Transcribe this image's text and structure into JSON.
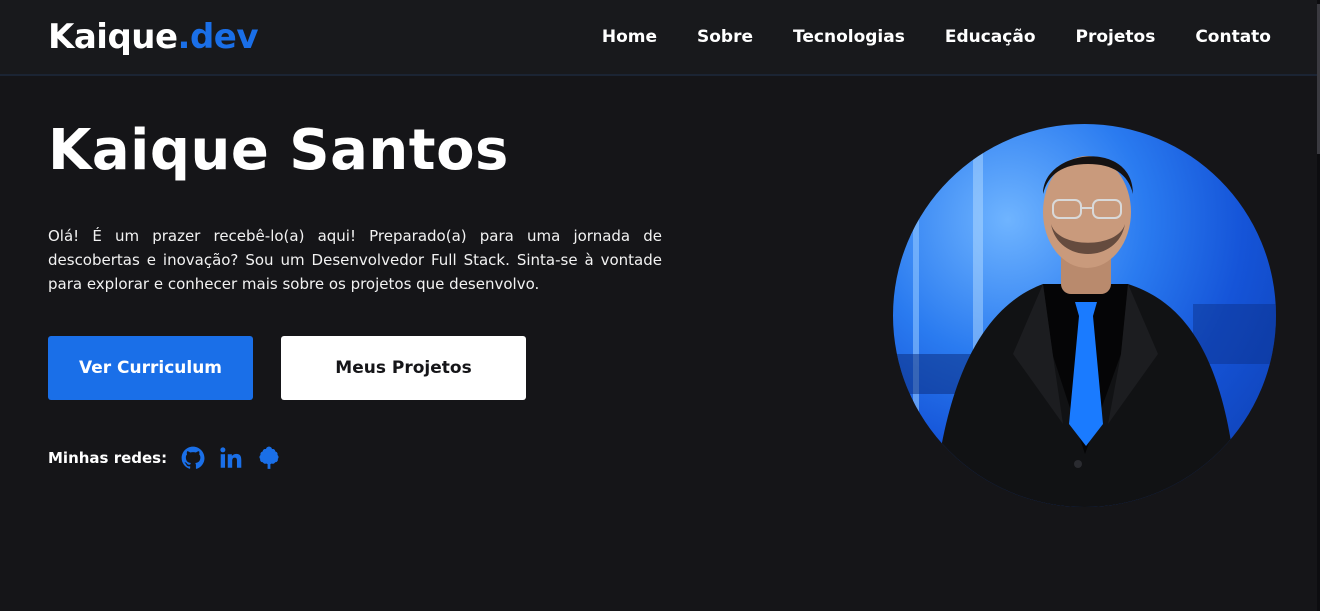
{
  "nav": {
    "logo_main": "Kaique",
    "logo_accent": ".dev",
    "links": [
      "Home",
      "Sobre",
      "Tecnologias",
      "Educação",
      "Projetos",
      "Contato"
    ]
  },
  "hero": {
    "title": "Kaique Santos",
    "text": "Olá! É um prazer recebê-lo(a) aqui! Preparado(a) para uma jornada de descobertas e inovação? Sou um Desenvolvedor Full Stack. Sinta-se à vontade para explorar e conhecer mais sobre os projetos que desenvolvo.",
    "primary_button": "Ver Curriculum",
    "secondary_button": "Meus Projetos"
  },
  "socials": {
    "label": "Minhas redes:",
    "icons": [
      "github-icon",
      "linkedin-icon",
      "devto-tree-icon"
    ]
  },
  "colors": {
    "accent": "#1a6fe8",
    "background": "#151518",
    "navbar": "#18191c"
  }
}
